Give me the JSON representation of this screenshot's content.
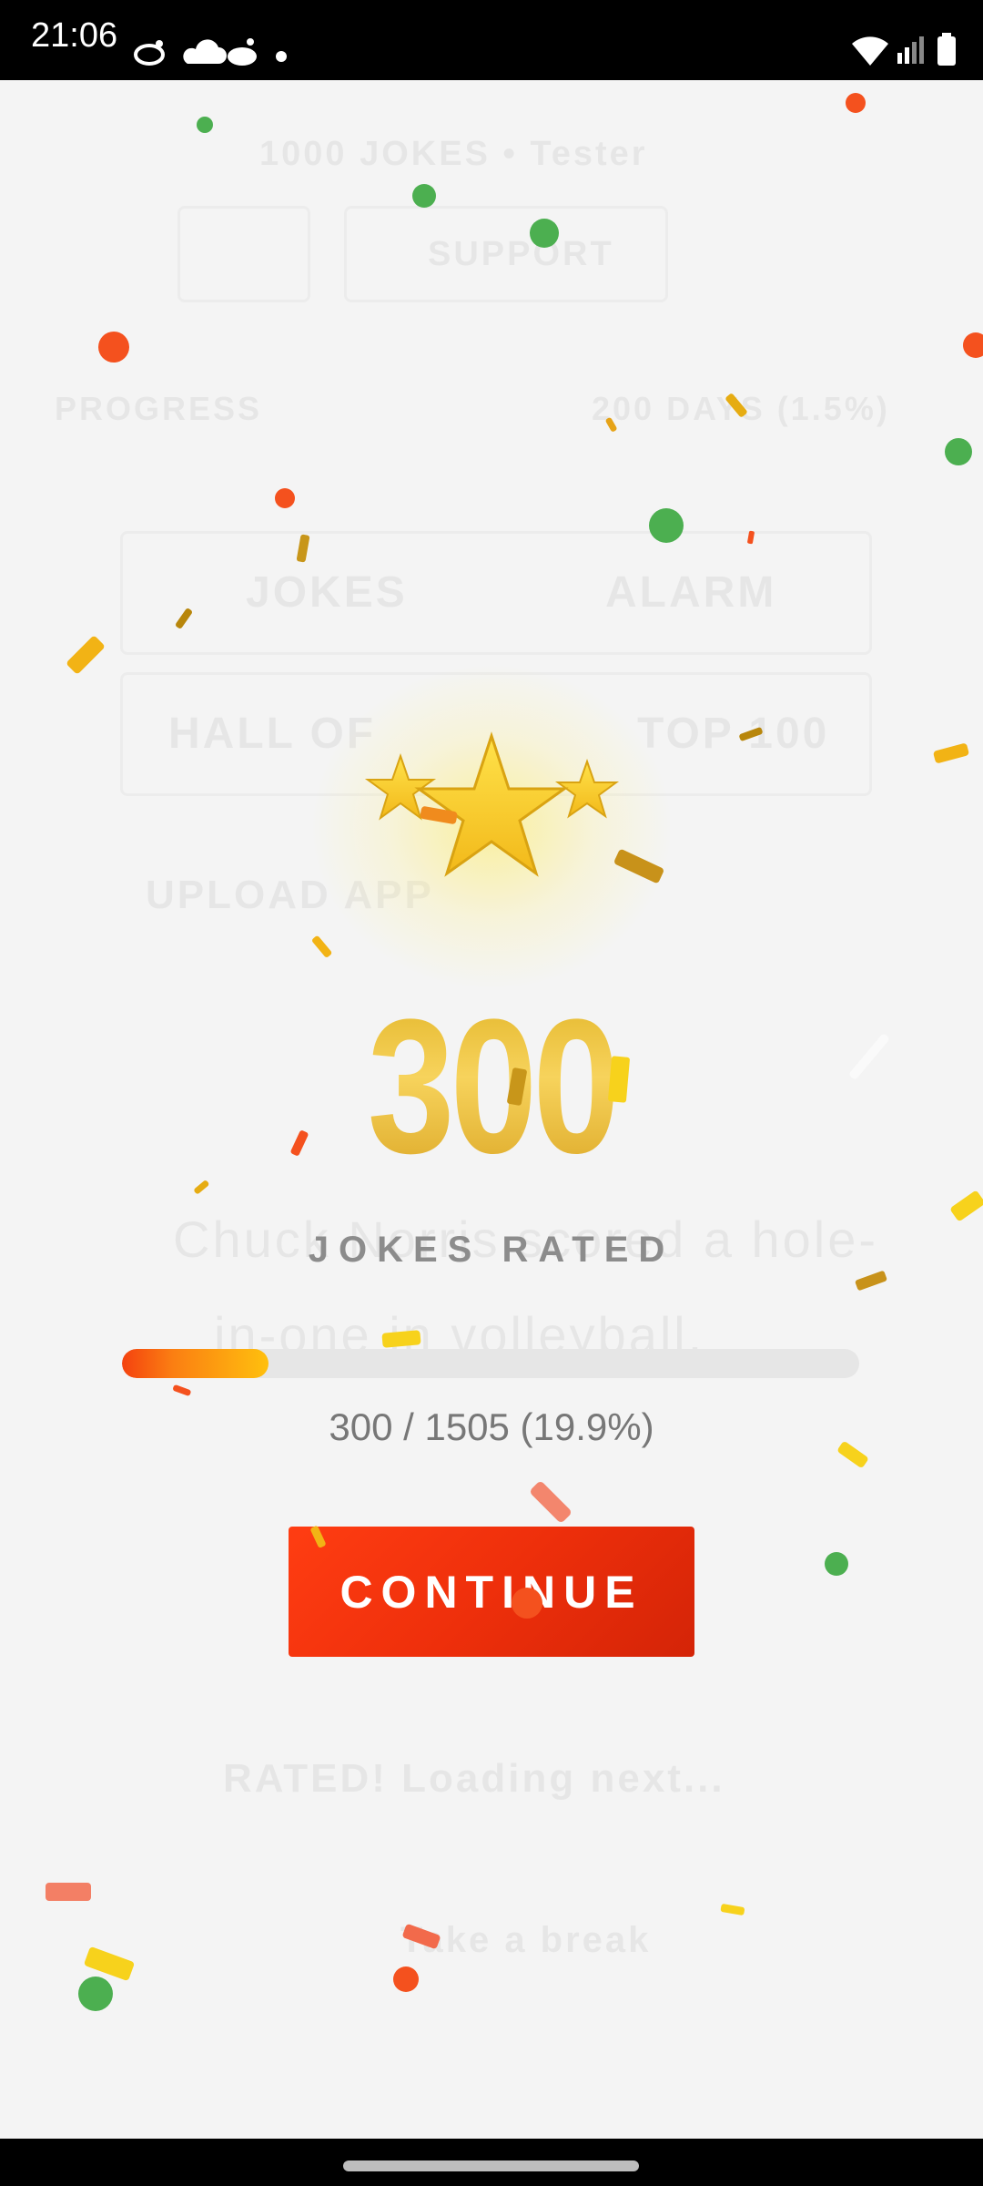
{
  "status_bar": {
    "time": "21:06",
    "left_icons": [
      "reddit-bird-icon",
      "cloud-icon",
      "reddit-icon",
      "dot-icon"
    ],
    "right_icons": [
      "wifi-icon",
      "signal-icon",
      "battery-icon"
    ]
  },
  "background": {
    "subtitle": "1000 JOKES • Tester",
    "support_label": "SUPPORT",
    "tab_left": "PROGRESS",
    "tab_right": "200 DAYS (1.5%)",
    "jokes_label": "JOKES",
    "alarm_label": "ALARM",
    "hall_label": "HALL OF",
    "top_label": "TOP 100",
    "upload_label": "UPLOAD APP",
    "joke_text_line1": "Chuck Norris scored a hole-",
    "joke_text_line2": "in-one in volleyball.",
    "rated_label": "RATED! Loading next...",
    "break_label": "Take a break"
  },
  "celebration": {
    "count": "300",
    "caption": "JOKES RATED",
    "progress_text": "300 / 1505 (19.9%)",
    "progress_fraction": 0.199,
    "continue_label": "CONTINUE"
  },
  "colors": {
    "accent": "#ee2f0b",
    "gold": "#f2c83a",
    "confetti_green": "#4caf50",
    "confetti_orange": "#f4511e",
    "confetti_yellow": "#f7d21c"
  }
}
